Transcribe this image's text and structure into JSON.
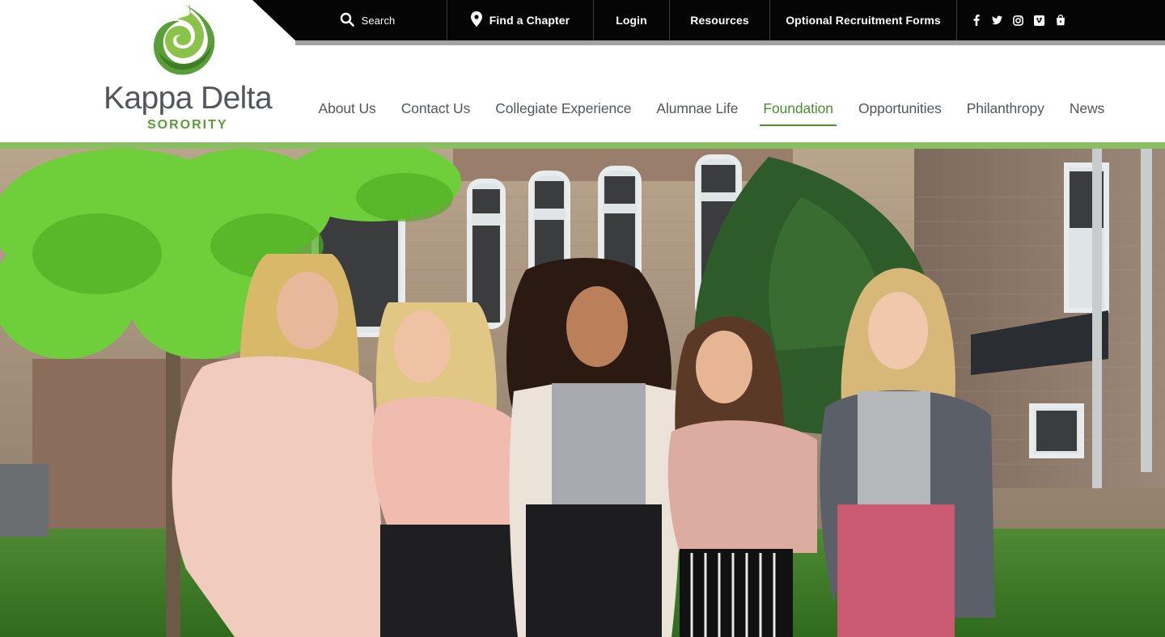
{
  "site": {
    "logo_name": "Kappa Delta",
    "logo_sub": "SORORITY"
  },
  "utility_nav": {
    "search_label": "Search",
    "find_chapter_label": "Find a Chapter",
    "login_label": "Login",
    "resources_label": "Resources",
    "forms_label": "Optional Recruitment Forms",
    "socials": [
      "facebook-icon",
      "twitter-icon",
      "instagram-icon",
      "vimeo-icon",
      "shopping-bag-icon"
    ]
  },
  "main_nav": {
    "items": [
      {
        "label": "About Us"
      },
      {
        "label": "Contact Us"
      },
      {
        "label": "Collegiate Experience"
      },
      {
        "label": "Alumnae Life"
      },
      {
        "label": "Foundation"
      },
      {
        "label": "Opportunities"
      },
      {
        "label": "Philanthropy"
      },
      {
        "label": "News"
      }
    ],
    "active": "Foundation"
  },
  "colors": {
    "brand_green": "#4c8f2e",
    "accent_green_bar": "#8bbd62",
    "utility_bar": "#050505",
    "nav_text": "#53565a"
  }
}
